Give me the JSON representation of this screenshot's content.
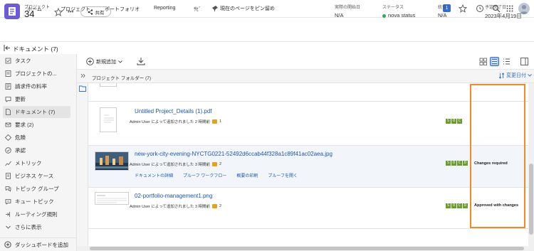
{
  "topnav": {
    "items": [
      "ホーム",
      "プロジェクト",
      "ポートフォリオ",
      "Reporting",
      "ｻﾋﾞ"
    ],
    "pin_label": "現在のページをピン留め",
    "badge": "1"
  },
  "project": {
    "label": "プロジェクト",
    "number": "34",
    "share_label": "共有",
    "more": "•••"
  },
  "meta": {
    "actual_start_label": "実際の開始日",
    "actual_start_value": "N/A",
    "status_label": "ステータス",
    "status_value": "nova status",
    "status_color": "#3aa65b",
    "integration_label": "統合",
    "integration_value": "N/A",
    "planned_end_label": "予定完了日",
    "planned_end_value": "2023年4月19日"
  },
  "section_title": "ドキュメント (7)",
  "sidebar": {
    "items": [
      {
        "label": "タスク",
        "icon": "task-icon"
      },
      {
        "label": "プロジェクトの...",
        "icon": "project-icon"
      },
      {
        "label": "請求件の料率",
        "icon": "billing-icon"
      },
      {
        "label": "更新",
        "icon": "updates-icon"
      },
      {
        "label": "ドキュメント (7)",
        "icon": "documents-icon",
        "active": true
      },
      {
        "label": "要求 (2)",
        "icon": "requests-icon"
      },
      {
        "label": "危険",
        "icon": "risk-icon"
      },
      {
        "label": "承認",
        "icon": "approval-icon"
      },
      {
        "label": "メトリック",
        "icon": "metrics-icon"
      },
      {
        "label": "ビジネス ケース",
        "icon": "business-case-icon"
      },
      {
        "label": "トピック グループ",
        "icon": "topic-group-icon"
      },
      {
        "label": "キュー トピック",
        "icon": "queue-topic-icon"
      },
      {
        "label": "ルーティング規則",
        "icon": "routing-icon"
      },
      {
        "label": "さらに表示",
        "icon": "chevron-down-icon"
      }
    ],
    "add_dashboard": "ダッシュボードを追加"
  },
  "toolbar": {
    "add_new": "新規追加"
  },
  "folder": {
    "title": "プロジェクト フォルダー (7)",
    "sort_label": "変更日付"
  },
  "documents": [
    {
      "name": "Untitled Project_Details (1).pdf",
      "added_by": "Admin User によって追加されました 2 時間前",
      "comments": "1",
      "soc": [
        "S",
        "O",
        "C"
      ],
      "approval": ""
    },
    {
      "name": "new-york-city-evening-NYCTG0221-52492d6ccab44f328a1c89f41ac02aea.jpg",
      "added_by": "Admin User によって追加されました 3 時間前",
      "comments": "2",
      "soc": [
        "S",
        "O",
        "C",
        "D"
      ],
      "approval": "Changes required",
      "actions": [
        "ドキュメントの詳細",
        "プルーフ ワークフロー",
        "概要の印刷",
        "プルーフを開く"
      ]
    },
    {
      "name": "02-portfolio-management1.png",
      "added_by": "Admin User によって追加されました 3 時間前",
      "comments": "2",
      "soc": [
        "S",
        "O",
        "C",
        "D"
      ],
      "approval": "Approved with changes"
    }
  ]
}
